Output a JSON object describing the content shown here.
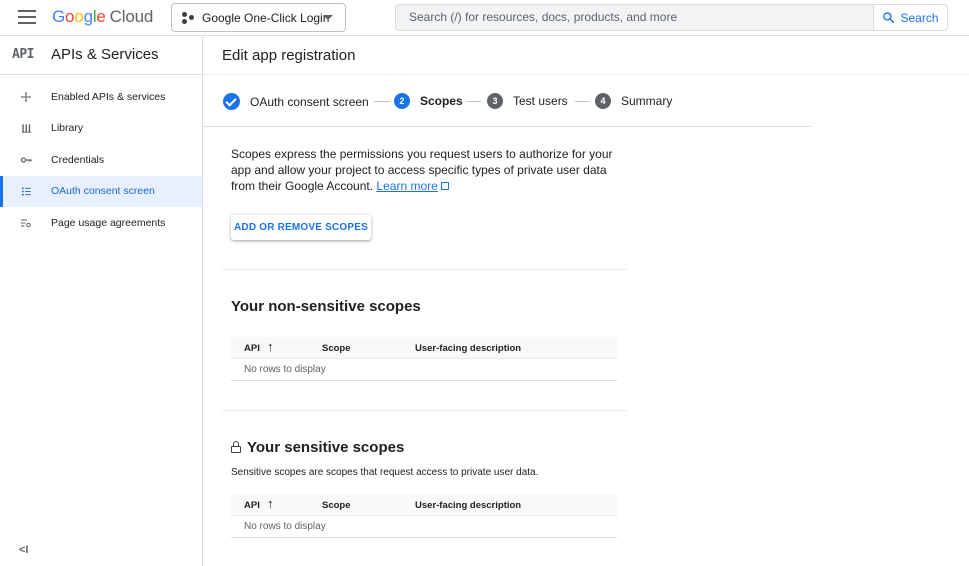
{
  "topbar": {
    "logo_letters": [
      "G",
      "o",
      "o",
      "g",
      "l",
      "e"
    ],
    "logo_suffix": "Cloud",
    "project_name": "Google One-Click Login",
    "search_placeholder": "Search (/) for resources, docs, products, and more",
    "search_button": "Search"
  },
  "sidebar": {
    "icon_text": "API",
    "title": "APIs & Services",
    "items": [
      {
        "label": "Enabled APIs & services",
        "icon": "move-icon",
        "active": false
      },
      {
        "label": "Library",
        "icon": "library-icon",
        "active": false
      },
      {
        "label": "Credentials",
        "icon": "key-icon",
        "active": false
      },
      {
        "label": "OAuth consent screen",
        "icon": "consent-icon",
        "active": true
      },
      {
        "label": "Page usage agreements",
        "icon": "settings-list-icon",
        "active": false
      }
    ],
    "collapse_icon": "<I"
  },
  "page": {
    "title": "Edit app registration"
  },
  "stepper": {
    "steps": [
      {
        "num": "",
        "label": "OAuth consent screen",
        "state": "done"
      },
      {
        "num": "2",
        "label": "Scopes",
        "state": "current"
      },
      {
        "num": "3",
        "label": "Test users",
        "state": "todo"
      },
      {
        "num": "4",
        "label": "Summary",
        "state": "todo"
      }
    ]
  },
  "intro": {
    "text": "Scopes express the permissions you request users to authorize for your app and allow your project to access specific types of private user data from their Google Account.",
    "link": "Learn more"
  },
  "add_scopes_button": "ADD OR REMOVE SCOPES",
  "non_sensitive": {
    "title": "Your non-sensitive scopes",
    "columns": [
      "API",
      "Scope",
      "User-facing description"
    ],
    "sort_arrow": "↑",
    "empty": "No rows to display"
  },
  "sensitive": {
    "title": "Your sensitive scopes",
    "description": "Sensitive scopes are scopes that request access to private user data.",
    "columns": [
      "API",
      "Scope",
      "User-facing description"
    ],
    "sort_arrow": "↑",
    "empty": "No rows to display"
  },
  "colors": {
    "accent": "#1a73e8",
    "active_bg": "#e8f0fe"
  }
}
